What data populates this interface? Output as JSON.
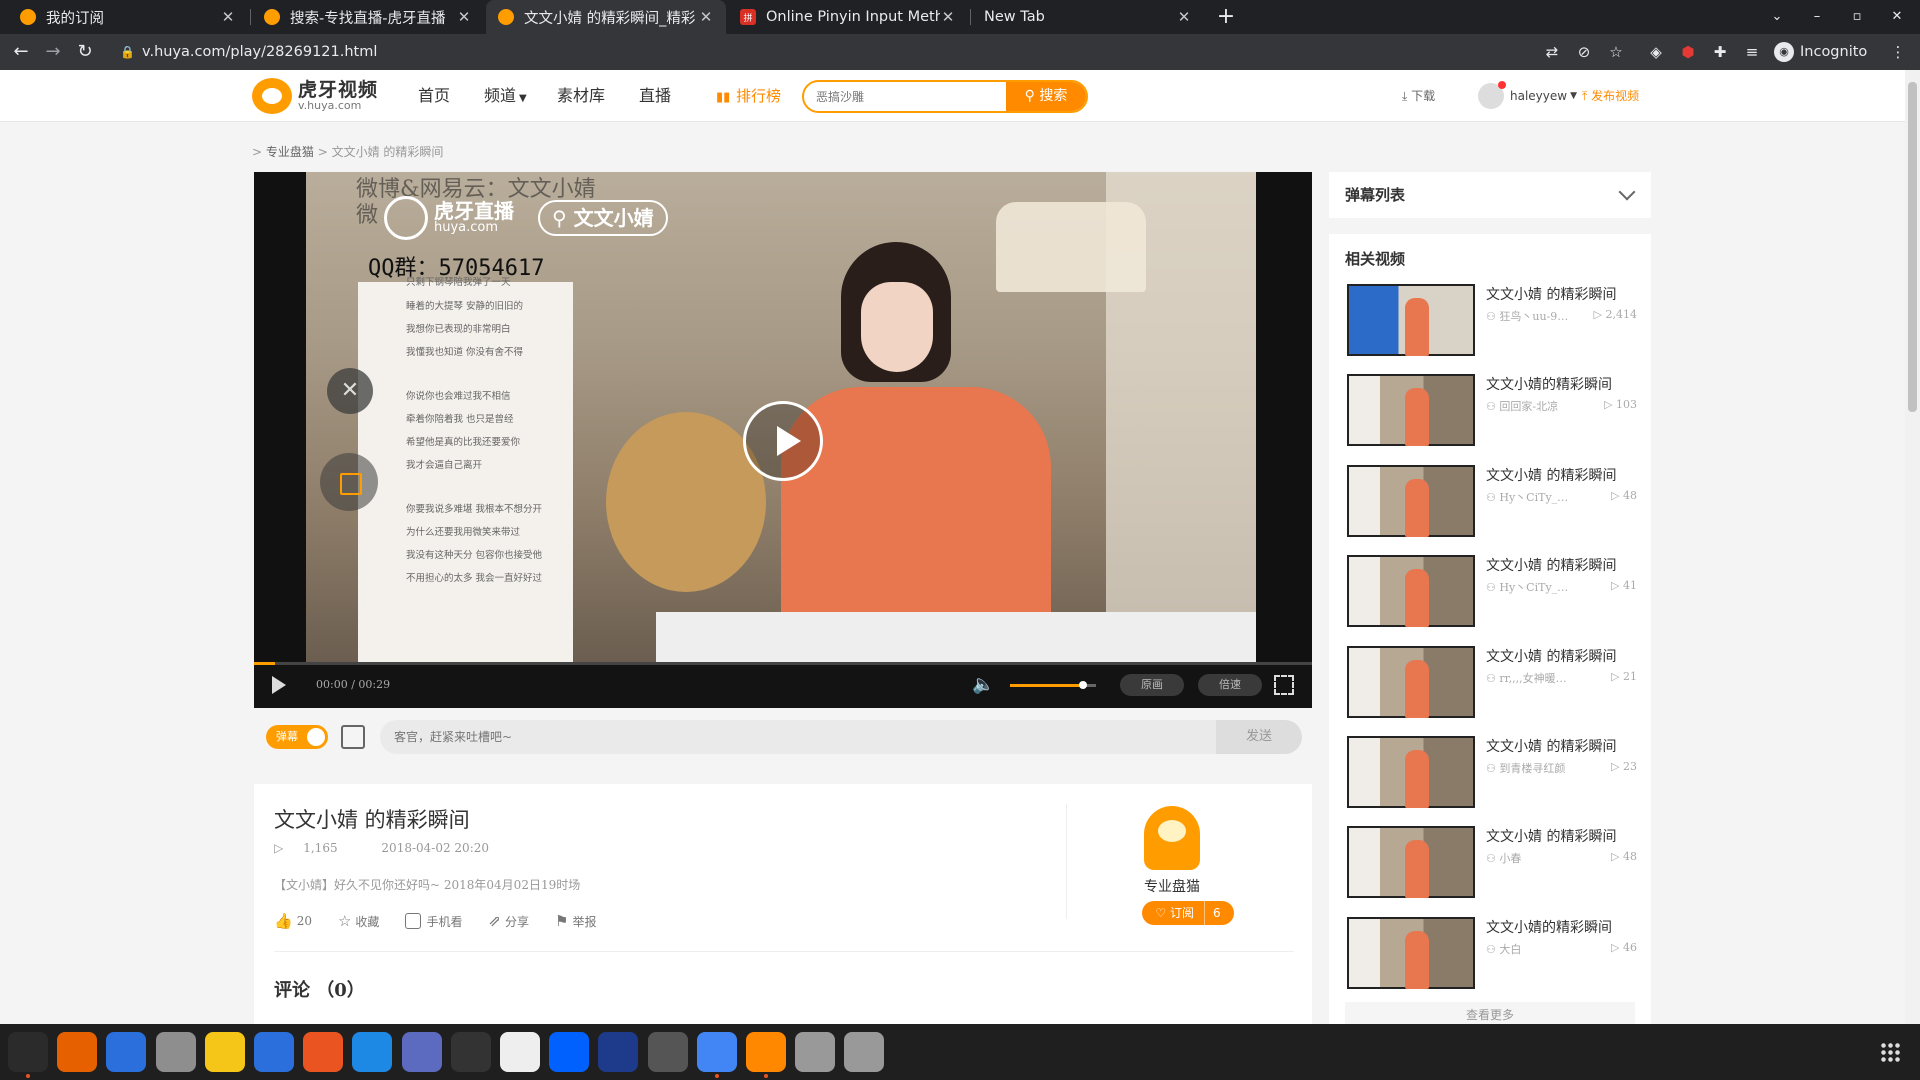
{
  "browser": {
    "tabs": [
      {
        "title": "我的订阅",
        "icon": "huya-favicon-icon"
      },
      {
        "title": "搜索-专找直播-虎牙直播",
        "icon": "huya-favicon-icon"
      },
      {
        "title": "文文小婧 的精彩瞬间_精彩",
        "icon": "huya-favicon-icon",
        "active": true
      },
      {
        "title": "Online Pinyin Input Metho",
        "icon": "pinyin-favicon-icon"
      },
      {
        "title": "New Tab",
        "icon": ""
      }
    ],
    "url": "v.huya.com/play/28269121.html",
    "incognito_label": "Incognito"
  },
  "site": {
    "logo_cn": "虎牙视频",
    "logo_en": "v.huya.com",
    "nav": [
      "首页",
      "频道",
      "素材库",
      "直播"
    ],
    "rank_label": "排行榜",
    "search_placeholder": "恶搞沙雕",
    "search_button": "搜索",
    "download_label": "下载",
    "username": "haleyyew",
    "upload_label": "发布视频"
  },
  "breadcrumb": {
    "parent": "专业盘猫",
    "current": "文文小婧 的精彩瞬间"
  },
  "player": {
    "watermark_line1": "微博&网易云：文文小婧",
    "watermark_line2": "微",
    "huya_wm_cn": "虎牙直播",
    "huya_wm_en": "huya.com",
    "huya_tag": "文文小婧",
    "qq": "QQ群：57054617",
    "lyrics": [
      "只剩下钢琴陪我弹了一天",
      "睡着的大提琴 安静的旧旧的",
      "我想你已表现的非常明白",
      "我懂我也知道 你没有舍不得",
      "你说你也会难过我不相信",
      "牵着你陪着我 也只是曾经",
      "希望他是真的比我还要爱你",
      "我才会逼自己离开",
      "你要我说多难堪 我根本不想分开",
      "为什么还要我用微笑来带过",
      "我没有这种天分 包容你也接受他",
      "不用担心的太多 我会一直好好过"
    ],
    "time_current": "00:00",
    "time_total": "00:29",
    "progress": 0.02,
    "volume": 0.85,
    "original_label": "原画",
    "speed_label": "倍速"
  },
  "danmu": {
    "toggle_label": "弹幕",
    "input_placeholder": "客官，赶紧来吐槽吧~",
    "send_label": "发送"
  },
  "video": {
    "title": "文文小婧 的精彩瞬间",
    "plays": "1,165",
    "date": "2018-04-02 20:20",
    "description": "【文小婧】好久不见你还好吗~ 2018年04月02日19时场",
    "likes": "20",
    "actions": [
      "收藏",
      "手机看",
      "分享",
      "举报"
    ],
    "channel_name": "专业盘猫",
    "subscribe_label": "订阅",
    "subscribe_count": "6",
    "comments_label": "评论",
    "comments_count": "（0）"
  },
  "sidebar": {
    "danmu_list_title": "弹幕列表",
    "related_title": "相关视频",
    "related": [
      {
        "title": "文文小婧 的精彩瞬间",
        "author": "狂鸟丶uu-9…",
        "views": "2,414"
      },
      {
        "title": "文文小婧的精彩瞬间",
        "author": "回回家-北凉",
        "views": "103"
      },
      {
        "title": "文文小婧 的精彩瞬间",
        "author": "Hy丶CiTy_…",
        "views": "48"
      },
      {
        "title": "文文小婧 的精彩瞬间",
        "author": "Hy丶CiTy_…",
        "views": "41"
      },
      {
        "title": "文文小婧 的精彩瞬间",
        "author": "rr,,,,女神暖…",
        "views": "21"
      },
      {
        "title": "文文小婧 的精彩瞬间",
        "author": "到青楼寻红颜",
        "views": "23"
      },
      {
        "title": "文文小婧 的精彩瞬间",
        "author": "小春",
        "views": "48"
      },
      {
        "title": "文文小婧的精彩瞬间",
        "author": "大白",
        "views": "46"
      }
    ],
    "more_label": "查看更多"
  },
  "taskbar": {
    "apps": [
      "system-monitor-icon",
      "firefox-icon",
      "thunderbird-icon",
      "files-icon",
      "rhythmbox-icon",
      "writer-icon",
      "software-center-icon",
      "help-icon",
      "screenshot-icon",
      "terminal-icon",
      "text-editor-icon",
      "dropbox-icon",
      "vpn-shield-icon",
      "vmware-icon",
      "chrome-icon",
      "vlc-icon",
      "disk-icon",
      "disk-icon-2"
    ]
  },
  "colors": {
    "accent": "#ff9d00",
    "accent_dark": "#ff8a00",
    "chrome_bg": "#202124"
  }
}
